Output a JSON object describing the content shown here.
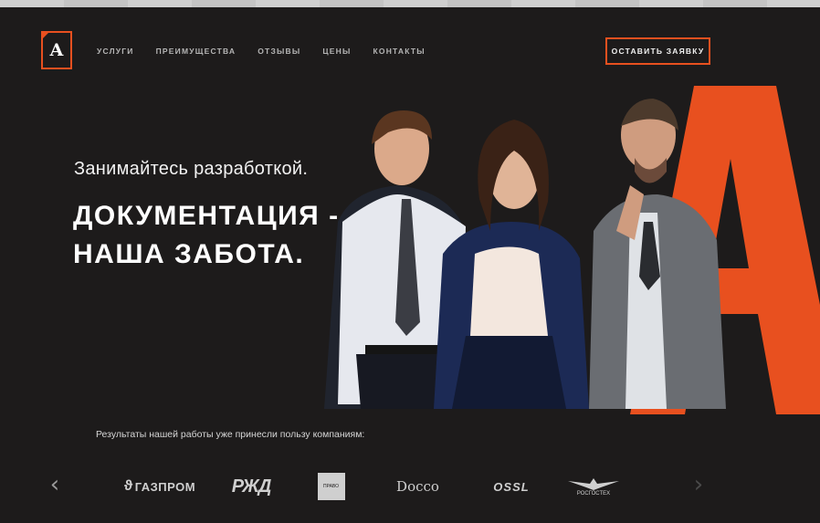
{
  "logo": {
    "letter": "А"
  },
  "nav": [
    "УСЛУГИ",
    "ПРЕИМУЩЕСТВА",
    "ОТЗЫВЫ",
    "ЦЕНЫ",
    "КОНТАКТЫ"
  ],
  "cta_label": "ОСТАВИТЬ ЗАЯВКУ",
  "hero": {
    "tagline": "Занимайтесь разработкой.",
    "headline_line1": "ДОКУМЕНТАЦИЯ -",
    "headline_line2": "НАША ЗАБОТА."
  },
  "clients": {
    "title": "Результаты нашей работы уже принесли пользу компаниям:",
    "logos": {
      "gazprom": "ГАЗПРОМ",
      "rzd": "РЖД",
      "pravo": "ПРАВО",
      "docco": "Docco",
      "ossl": "OSSL",
      "agency": "РОСГОСТЕХ"
    },
    "prev": "‹",
    "next": "›"
  },
  "colors": {
    "accent": "#e8501f",
    "background": "#1d1b1b"
  }
}
